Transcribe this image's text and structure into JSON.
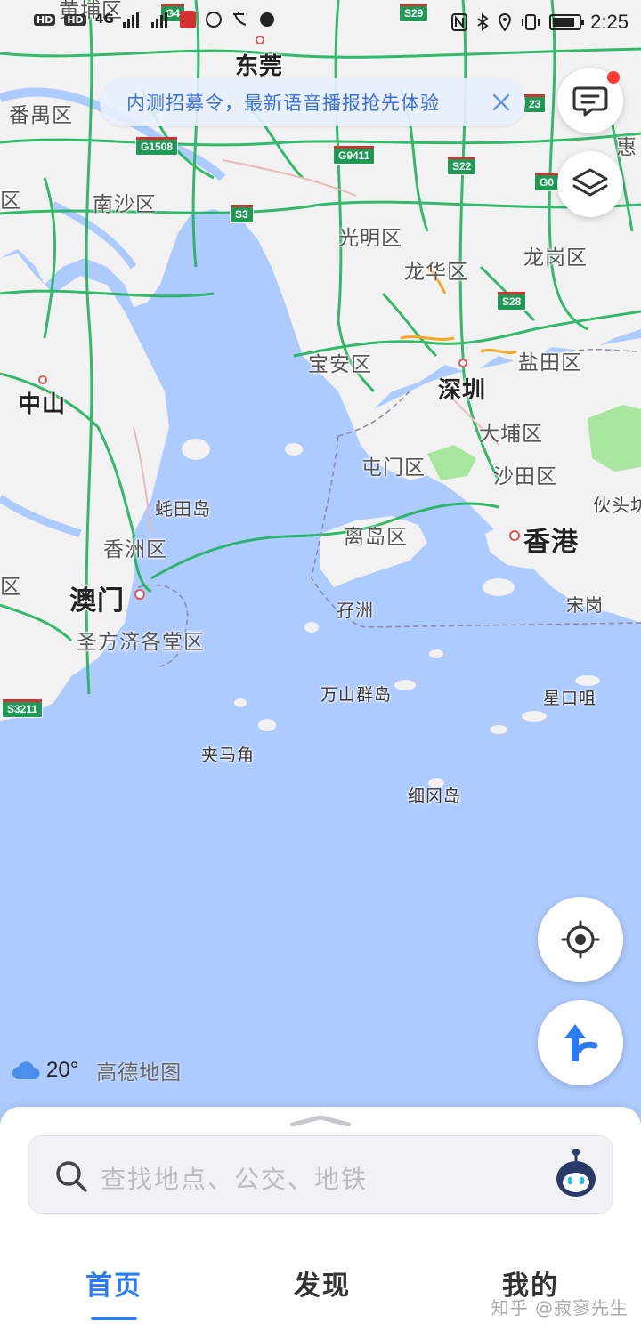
{
  "status_bar": {
    "hd1": "HD",
    "hd2": "HD",
    "net": "4G",
    "time": "2:25"
  },
  "notice": {
    "text": "内测招募令，最新语音播报抢先体验"
  },
  "map": {
    "labels": {
      "huangpu": "黄埔区",
      "dongguan": "东莞",
      "panyu": "番禺区",
      "hui": "惠",
      "nansha": "南沙区",
      "qu_left": "区",
      "guangming": "光明区",
      "longhua": "龙华区",
      "longgang": "龙岗区",
      "zhongshan": "中山",
      "baoan": "宝安区",
      "shenzhen": "深圳",
      "yantian": "盐田区",
      "dapu": "大埔区",
      "tunmen": "屯门区",
      "shatian": "沙田区",
      "youtou": "伙头坊",
      "hengqin": "蚝田岛",
      "xiangzhou": "香洲区",
      "lidao": "离岛区",
      "hongkong": "香港",
      "qu_left2": "区",
      "macau": "澳门",
      "zaizhou": "孖洲",
      "songgang": "宋岗",
      "shengfang": "圣方济各堂区",
      "wanshan": "万山群岛",
      "xingkou": "星口咀",
      "jiama": "夹马角",
      "xigang": "细冈岛"
    },
    "shields": {
      "g4": "G4",
      "s29": "S29",
      "g1508": "G1508",
      "g9411": "G9411",
      "s22": "S22",
      "s3": "S3",
      "g0": "G0",
      "n23": "23",
      "s28": "S28",
      "s3211": "S3211"
    }
  },
  "weather": {
    "temperature": "20°",
    "brand": "高德地图"
  },
  "search": {
    "placeholder": "查找地点、公交、地铁"
  },
  "tabs": [
    {
      "label": "首页",
      "active": true
    },
    {
      "label": "发现",
      "active": false
    },
    {
      "label": "我的",
      "active": false
    }
  ],
  "watermark": "知乎 @寂寥先生",
  "colors": {
    "accent": "#2a7bf6",
    "water": "#aecbff",
    "land": "#f2f2f2",
    "highway": "#1fb35c"
  }
}
